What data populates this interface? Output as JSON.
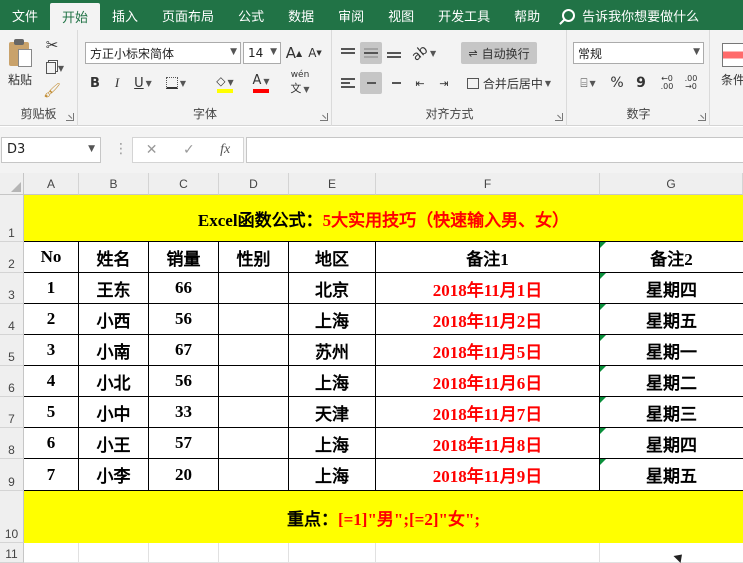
{
  "menu": {
    "tabs": [
      "文件",
      "开始",
      "插入",
      "页面布局",
      "公式",
      "数据",
      "审阅",
      "视图",
      "开发工具",
      "帮助"
    ],
    "active_index": 1,
    "tell_me": "告诉我你想要做什么"
  },
  "ribbon": {
    "clipboard": {
      "paste": "粘贴",
      "label": "剪贴板"
    },
    "font": {
      "name": "方正小标宋简体",
      "size": "14",
      "grow": "A",
      "shrink": "A",
      "bold": "B",
      "italic": "I",
      "underline": "U",
      "font_color_letter": "A",
      "phonetic": "wén",
      "label": "字体"
    },
    "alignment": {
      "wrap_text": "自动换行",
      "merge_center": "合并后居中",
      "label": "对齐方式"
    },
    "number": {
      "format": "常规",
      "percent": "%",
      "comma": "9",
      "label": "数字"
    },
    "styles": {
      "conditional": "条件"
    }
  },
  "formula_bar": {
    "name_box": "D3",
    "fx": "fx",
    "cancel": "✕",
    "enter": "✓",
    "content": ""
  },
  "sheet": {
    "columns": [
      "A",
      "B",
      "C",
      "D",
      "E",
      "F",
      "G"
    ],
    "rows": [
      "1",
      "2",
      "3",
      "4",
      "5",
      "6",
      "7",
      "8",
      "9",
      "10",
      "11"
    ],
    "title_black": "Excel函数公式：",
    "title_red": "5大实用技巧（快速输入男、女）",
    "headers": [
      "No",
      "姓名",
      "销量",
      "性别",
      "地区",
      "备注1",
      "备注2"
    ],
    "data": [
      [
        "1",
        "王东",
        "66",
        "",
        "北京",
        "2018年11月1日",
        "星期四"
      ],
      [
        "2",
        "小西",
        "56",
        "",
        "上海",
        "2018年11月2日",
        "星期五"
      ],
      [
        "3",
        "小南",
        "67",
        "",
        "苏州",
        "2018年11月5日",
        "星期一"
      ],
      [
        "4",
        "小北",
        "56",
        "",
        "上海",
        "2018年11月6日",
        "星期二"
      ],
      [
        "5",
        "小中",
        "33",
        "",
        "天津",
        "2018年11月7日",
        "星期三"
      ],
      [
        "6",
        "小王",
        "57",
        "",
        "上海",
        "2018年11月8日",
        "星期四"
      ],
      [
        "7",
        "小李",
        "20",
        "",
        "上海",
        "2018年11月9日",
        "星期五"
      ]
    ],
    "footer_black": "重点：",
    "footer_red": "[=1]\"男\";[=2]\"女\";",
    "colors": {
      "banner": "#ffff00",
      "red_text": "#ff0000",
      "excel_green": "#217346"
    }
  }
}
